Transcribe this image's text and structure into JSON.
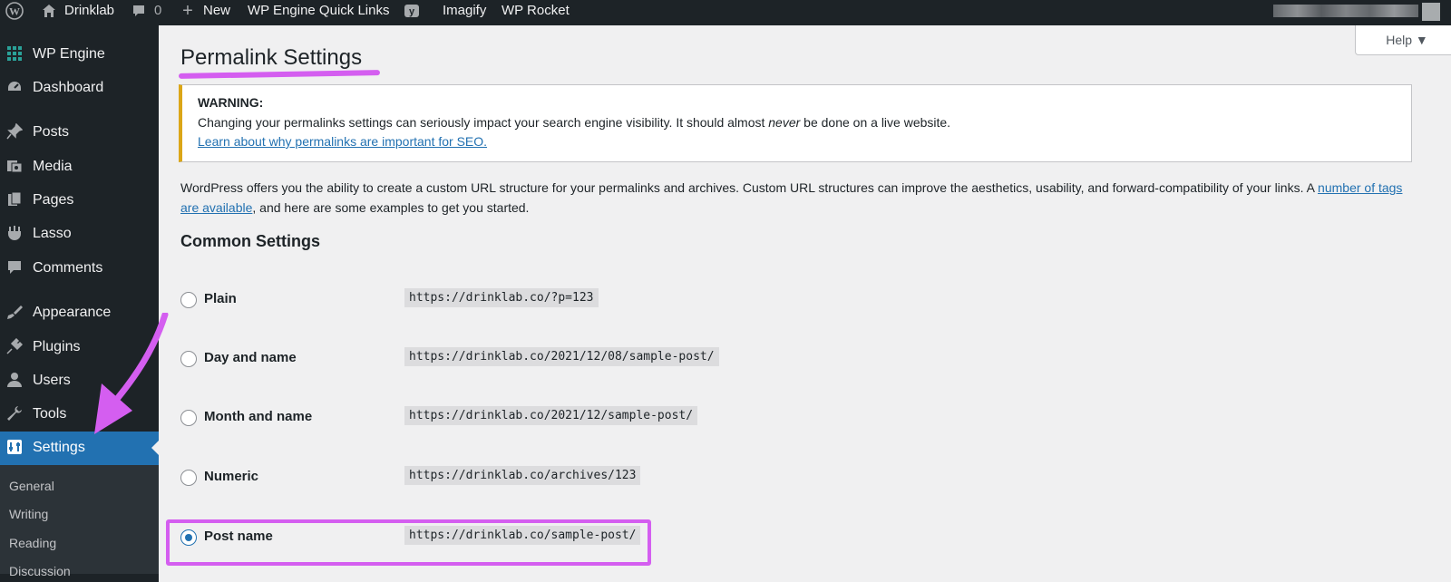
{
  "admin_bar": {
    "site_name": "Drinklab",
    "comments_count": "0",
    "new_label": "New",
    "items": [
      "WP Engine Quick Links",
      "Imagify",
      "WP Rocket"
    ]
  },
  "sidebar": {
    "items": [
      {
        "label": "WP Engine",
        "icon": "grid-icon"
      },
      {
        "label": "Dashboard",
        "icon": "dashboard-icon"
      },
      {
        "label": "Posts",
        "icon": "pin-icon"
      },
      {
        "label": "Media",
        "icon": "media-icon"
      },
      {
        "label": "Pages",
        "icon": "pages-icon"
      },
      {
        "label": "Lasso",
        "icon": "lasso-icon"
      },
      {
        "label": "Comments",
        "icon": "comments-icon"
      },
      {
        "label": "Appearance",
        "icon": "brush-icon"
      },
      {
        "label": "Plugins",
        "icon": "plugin-icon"
      },
      {
        "label": "Users",
        "icon": "users-icon"
      },
      {
        "label": "Tools",
        "icon": "wrench-icon"
      },
      {
        "label": "Settings",
        "icon": "settings-icon"
      }
    ],
    "submenu": [
      "General",
      "Writing",
      "Reading",
      "Discussion"
    ]
  },
  "main": {
    "help_label": "Help ▼",
    "title": "Permalink Settings",
    "notice": {
      "heading": "WARNING:",
      "text_before": "Changing your permalinks settings can seriously impact your search engine visibility. It should almost ",
      "text_em": "never",
      "text_after": " be done on a live website.",
      "link": "Learn about why permalinks are important for SEO."
    },
    "intro": {
      "text": "WordPress offers you the ability to create a custom URL structure for your permalinks and archives. Custom URL structures can improve the aesthetics, usability, and forward-compatibility of your links. A ",
      "link": "number of tags are available",
      "text_after": ", and here are some examples to get you started."
    },
    "section_title": "Common Settings",
    "options": [
      {
        "label": "Plain",
        "example": "https://drinklab.co/?p=123",
        "checked": false
      },
      {
        "label": "Day and name",
        "example": "https://drinklab.co/2021/12/08/sample-post/",
        "checked": false
      },
      {
        "label": "Month and name",
        "example": "https://drinklab.co/2021/12/sample-post/",
        "checked": false
      },
      {
        "label": "Numeric",
        "example": "https://drinklab.co/archives/123",
        "checked": false
      },
      {
        "label": "Post name",
        "example": "https://drinklab.co/sample-post/",
        "checked": true
      }
    ]
  },
  "colors": {
    "admin_dark": "#1d2327",
    "accent": "#2271b1",
    "annotation": "#d45ef0",
    "warning": "#dba617"
  }
}
